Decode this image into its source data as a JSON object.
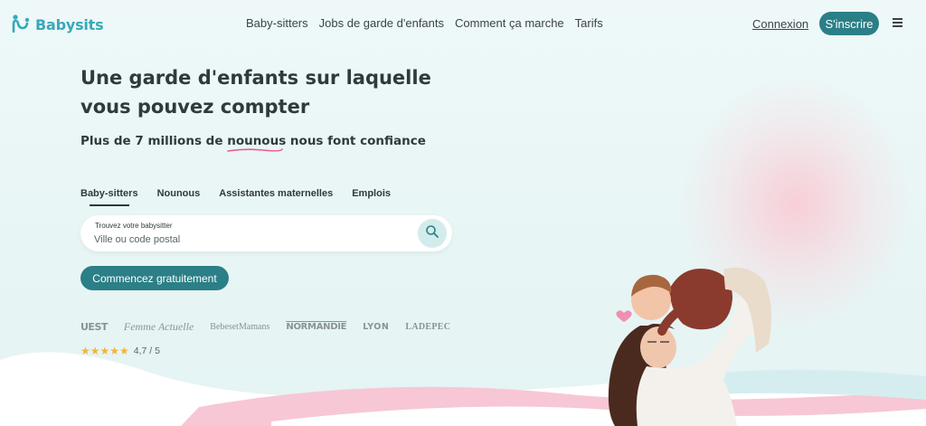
{
  "header": {
    "logo_text": "Babysits",
    "nav": [
      "Baby-sitters",
      "Jobs de garde d'enfants",
      "Comment ça marche",
      "Tarifs"
    ],
    "login_label": "Connexion",
    "signup_label": "S'inscrire"
  },
  "hero": {
    "title": "Une garde d'enfants sur laquelle vous pouvez compter",
    "subtitle_before": "Plus de 7 millions de ",
    "subtitle_highlight": "nounous",
    "subtitle_after": " nous font confiance"
  },
  "tabs": [
    {
      "label": "Baby-sitters",
      "active": true
    },
    {
      "label": "Nounous",
      "active": false
    },
    {
      "label": "Assistantes maternelles",
      "active": false
    },
    {
      "label": "Emplois",
      "active": false
    }
  ],
  "search": {
    "label": "Trouvez votre babysitter",
    "placeholder": "Ville ou code postal"
  },
  "cta_label": "Commencez gratuitement",
  "press_logos": [
    "UEST",
    "Femme Actuelle",
    "BebesetMamans",
    "NORMANDIE",
    "LYON",
    "LADEPEC"
  ],
  "rating": {
    "stars": "★★★★★",
    "text": "4,7 / 5"
  },
  "colors": {
    "accent": "#2b7f86",
    "brand": "#3aa8b8",
    "highlight": "#e85d8a",
    "star": "#f1b53c"
  }
}
